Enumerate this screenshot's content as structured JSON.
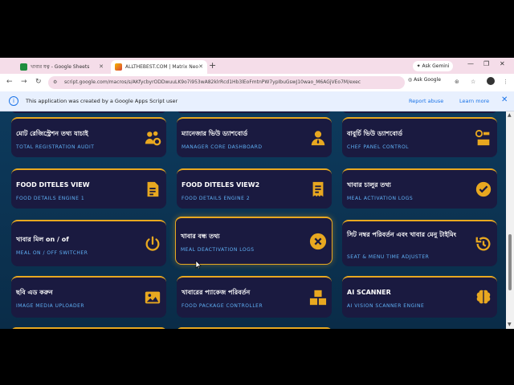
{
  "tabs": [
    {
      "label": "খাবার যত্ন - Google Sheets",
      "active": false
    },
    {
      "label": "ALLTHEBEST.COM | Matrix Neo",
      "active": true
    }
  ],
  "ask_gemini": "Ask Gemini",
  "url": "script.google.com/macros/s/AKfycbyrODDwuuLK9o7i953wA82klrRcd1Hb3lEoFmtnPW7ypIbuGswJ10wao_M6AGjVEo7M/exec",
  "ask_google": "Ask Google",
  "infobar": {
    "text": "This application was created by a Google Apps Script user",
    "report": "Report abuse",
    "learn": "Learn more"
  },
  "cards": [
    {
      "title": "মোট রেজিস্ট্রেশন তথ্য যাচাই",
      "sub": "TOTAL REGISTRATION AUDIT",
      "icon": "users-gear-icon"
    },
    {
      "title": "ম্যানেজার ভিউ ড্যাশবোর্ড",
      "sub": "MANAGER CORE DASHBOARD",
      "icon": "manager-icon"
    },
    {
      "title": "বাবুর্চি ভিউ ড্যাশবোর্ড",
      "sub": "CHEF PANEL CONTROL",
      "icon": "chef-panel-icon"
    },
    {
      "title": "FOOD DITELES VIEW",
      "sub": "FOOD DETAILS ENGINE 1",
      "icon": "document-icon"
    },
    {
      "title": "FOOD DITELES VIEW2",
      "sub": "FOOD DETAILS ENGINE 2",
      "icon": "receipt-icon"
    },
    {
      "title": "খাবার চালুর তথ্য",
      "sub": "MEAL ACTIVATION LOGS",
      "icon": "check-circle-icon"
    },
    {
      "title": "খাবার মিল on / of",
      "sub": "MEAL ON / OFF SWITCHER",
      "icon": "power-icon"
    },
    {
      "title": "খাবার বন্ধ তথ্য",
      "sub": "MEAL DEACTIVATION LOGS",
      "icon": "close-circle-icon"
    },
    {
      "title": "সিট নম্বর পরিবর্তন এবং খাবার মেনু টাইমিং",
      "sub": "SEAT & MENU TIME ADJUSTER",
      "icon": "history-icon"
    },
    {
      "title": "ছবি এড করুন",
      "sub": "IMAGE MEDIA UPLOADER",
      "icon": "image-icon"
    },
    {
      "title": "খাবারের প্যাকেজ পরিবর্তন",
      "sub": "FOOD PACKAGE CONTROLLER",
      "icon": "boxes-icon"
    },
    {
      "title": "AI SCANNER",
      "sub": "AI VISION SCANNER ENGINE",
      "icon": "brain-icon"
    }
  ],
  "colors": {
    "accent": "#e8a820",
    "card": "#1a1a40",
    "subtitle": "#5fb0f5",
    "bg": "#0a2c48"
  }
}
